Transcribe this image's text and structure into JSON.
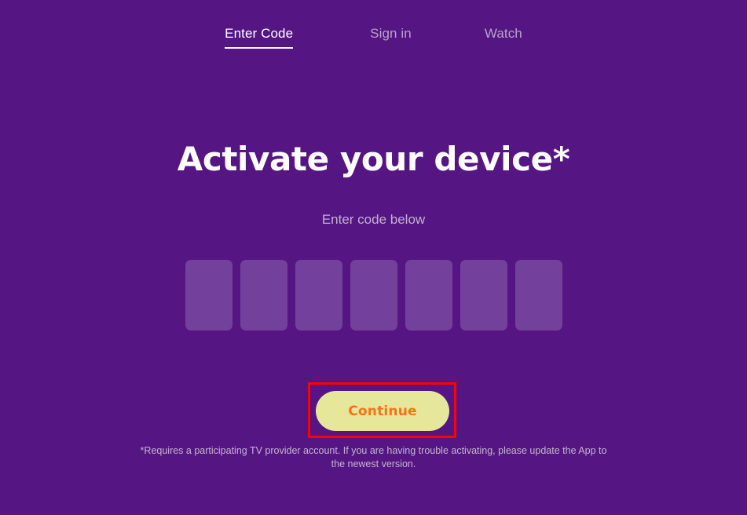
{
  "theme": {
    "background": "#551683",
    "code_box_fill": "#73409B",
    "cta_background": "#E6E79A",
    "cta_text_color": "#F97316",
    "highlight_border": "#FF0000",
    "active_nav_color": "#FFFFFF",
    "inactive_nav_color": "#B6A5C6",
    "muted_text": "#C0B0CD"
  },
  "nav": {
    "items": [
      {
        "label": "Enter Code",
        "active": true
      },
      {
        "label": "Sign in",
        "active": false
      },
      {
        "label": "Watch",
        "active": false
      }
    ]
  },
  "main": {
    "title": "Activate your device",
    "title_asterisk": "*",
    "subtitle": "Enter code below",
    "code_input": {
      "count": 7,
      "values": [
        "",
        "",
        "",
        "",
        "",
        "",
        ""
      ],
      "placeholder": ""
    },
    "cta": {
      "label": "Continue"
    },
    "footnote": "*Requires a participating TV provider account. If you are having trouble activating, please update the App to the newest version."
  }
}
